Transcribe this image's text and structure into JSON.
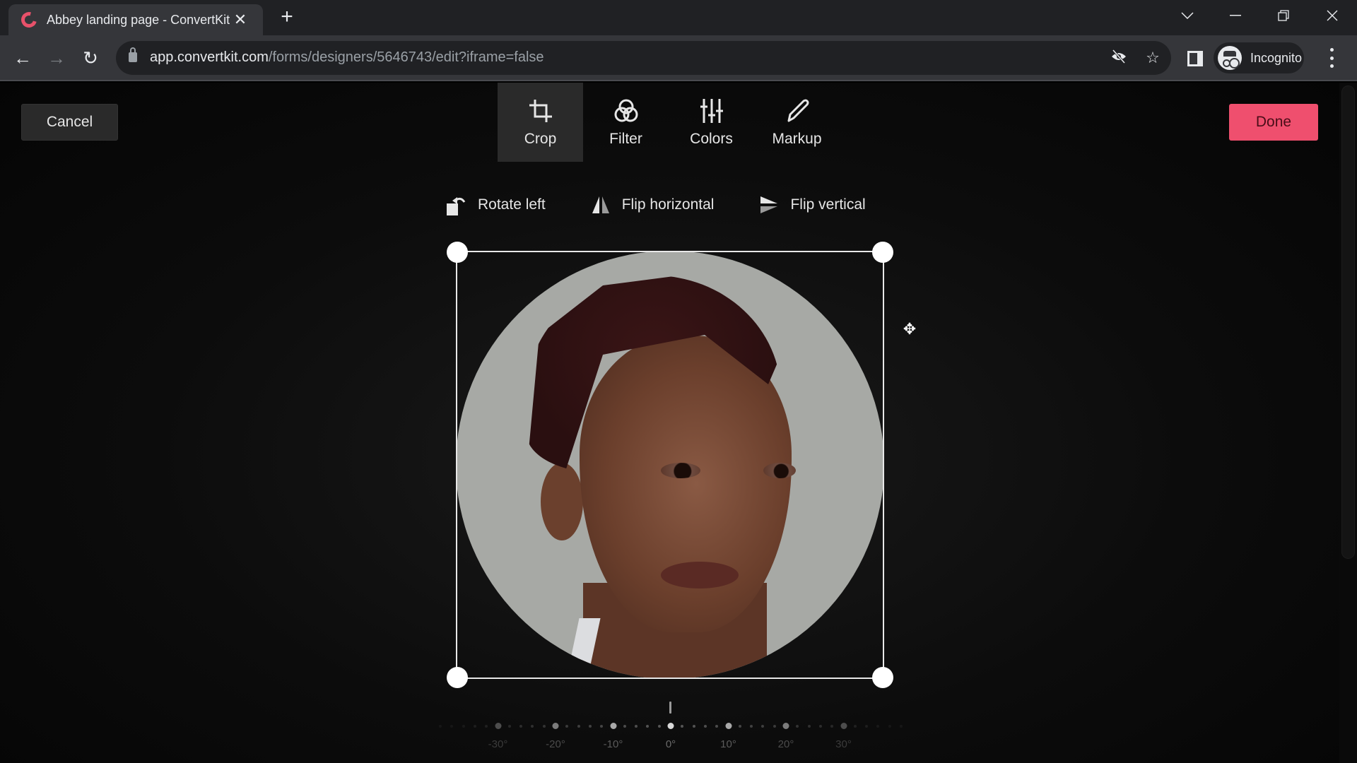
{
  "browser": {
    "tab_title": "Abbey landing page - ConvertKit",
    "tab_favicon": "convertkit-logo-icon",
    "new_tab_label": "+",
    "url_host": "app.convertkit.com",
    "url_path": "/forms/designers/5646743/edit?iframe=false",
    "profile_label": "Incognito",
    "brand_color": "#e8516a"
  },
  "editor": {
    "cancel_label": "Cancel",
    "done_label": "Done",
    "done_color": "#ef4f6e",
    "tools": [
      {
        "label": "Crop",
        "icon": "crop-icon",
        "active": true
      },
      {
        "label": "Filter",
        "icon": "filter-icon",
        "active": false
      },
      {
        "label": "Colors",
        "icon": "sliders-icon",
        "active": false
      },
      {
        "label": "Markup",
        "icon": "pencil-icon",
        "active": false
      }
    ],
    "crop_actions": [
      {
        "label": "Rotate left",
        "icon": "rotate-left-icon"
      },
      {
        "label": "Flip horizontal",
        "icon": "flip-horizontal-icon"
      },
      {
        "label": "Flip vertical",
        "icon": "flip-vertical-icon"
      }
    ],
    "image_alt": "Circular portrait photo of a woman with short hair on a light grey background",
    "rotation_dial": {
      "current_degrees": 0,
      "labels": [
        "-30°",
        "-20°",
        "-10°",
        "0°",
        "10°",
        "20°",
        "30°"
      ],
      "label_values": [
        -30,
        -20,
        -10,
        0,
        10,
        20,
        30
      ]
    }
  }
}
